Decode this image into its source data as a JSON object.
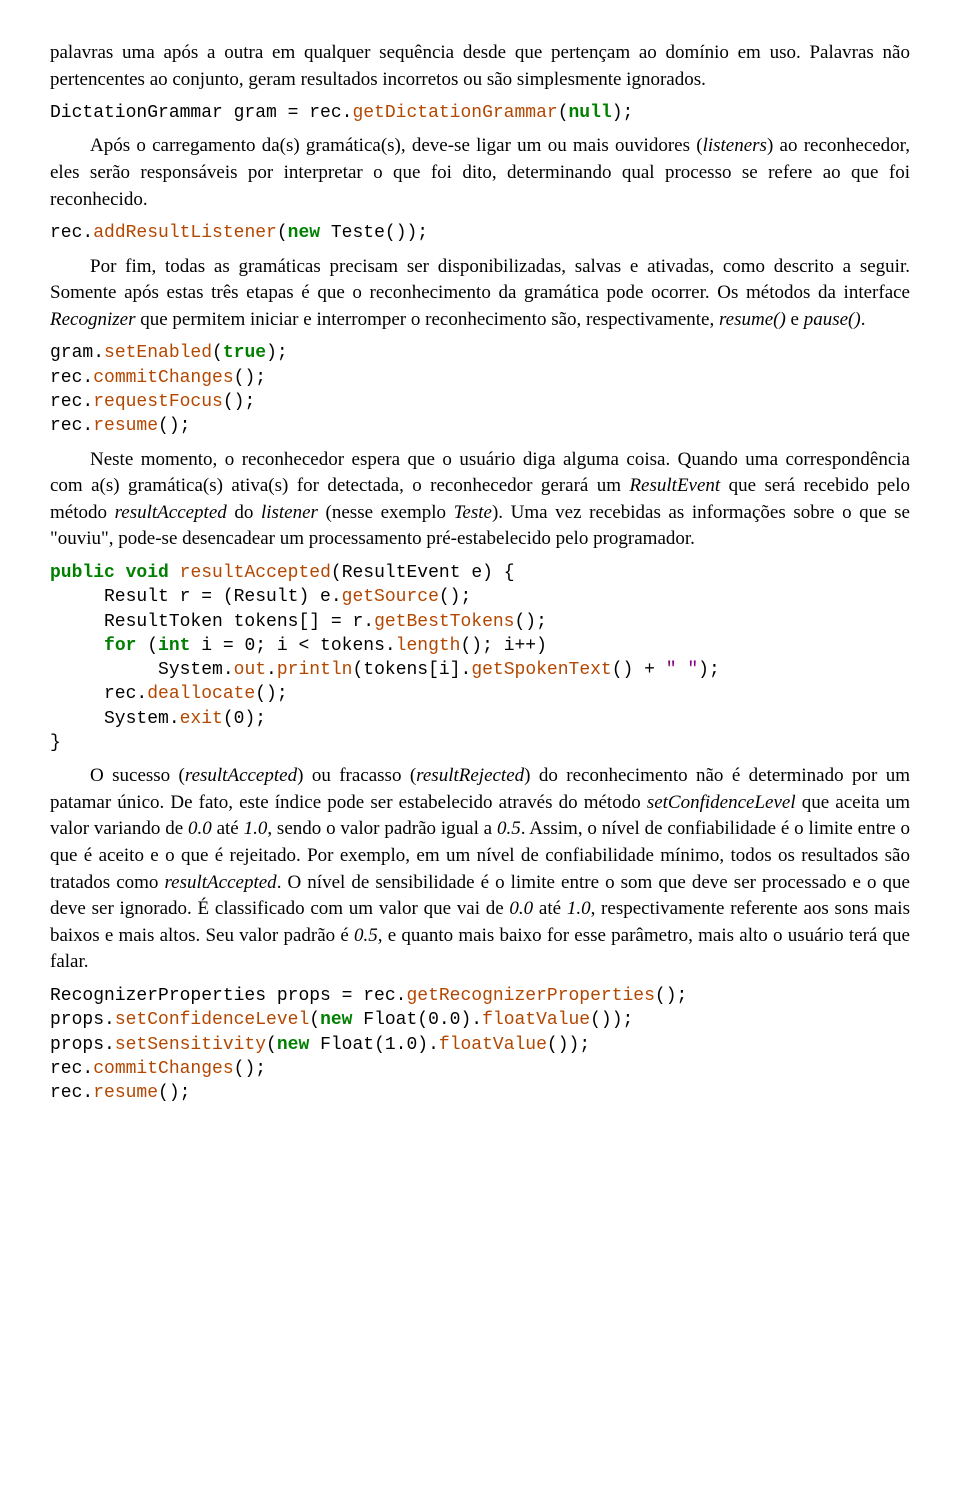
{
  "p1": "palavras uma após a outra em qualquer sequência desde que pertençam ao domínio em uso. Palavras não pertencentes ao conjunto, geram resultados incorretos ou são simplesmente ignorados.",
  "c1": {
    "a": "DictationGrammar gram = rec.",
    "b": "getDictationGrammar",
    "c": "(",
    "d": "null",
    "e": ");"
  },
  "p2a": "Após o carregamento da(s) gramática(s), deve-se ligar um ou mais ouvidores (",
  "p2b": "listeners",
  "p2c": ") ao reconhecedor, eles serão responsáveis por interpretar o que foi dito, determinando qual processo se refere ao que foi reconhecido.",
  "c2": {
    "a": "rec.",
    "b": "addResultListener",
    "c": "(",
    "d": "new",
    "e": " Teste());"
  },
  "p3a": "Por fim, todas as gramáticas precisam ser disponibilizadas, salvas e ativadas, como descrito a seguir. Somente após estas três etapas é que o reconhecimento da gramática pode ocorrer. Os métodos da interface ",
  "p3b": "Recognizer",
  "p3c": " que permitem iniciar e interromper o reconhecimento são, respectivamente, ",
  "p3d": "resume()",
  "p3e": " e ",
  "p3f": "pause()",
  "p3g": ".",
  "c3": {
    "l1a": "gram.",
    "l1b": "setEnabled",
    "l1c": "(",
    "l1d": "true",
    "l1e": ");",
    "l2a": "rec.",
    "l2b": "commitChanges",
    "l2c": "();",
    "l3a": "rec.",
    "l3b": "requestFocus",
    "l3c": "();",
    "l4a": "rec.",
    "l4b": "resume",
    "l4c": "();"
  },
  "p4a": "Neste momento, o reconhecedor espera que o usuário diga alguma coisa. Quando uma correspondência com a(s) gramática(s) ativa(s) for detectada, o reconhecedor gerará um ",
  "p4b": "ResultEvent",
  "p4c": " que será recebido pelo método ",
  "p4d": "resultAccepted",
  "p4e": " do ",
  "p4f": "listener",
  "p4g": " (nesse exemplo ",
  "p4h": "Teste",
  "p4i": "). Uma vez recebidas as informações sobre o que se \"ouviu\", pode-se desencadear um processamento pré-estabelecido pelo programador.",
  "c4": {
    "l1a": "public",
    "l1b": " ",
    "l1c": "void",
    "l1d": " ",
    "l1e": "resultAccepted",
    "l1f": "(ResultEvent e) {",
    "l2a": "     Result r = (Result) e.",
    "l2b": "getSource",
    "l2c": "();",
    "l3a": "     ResultToken tokens[] = r.",
    "l3b": "getBestTokens",
    "l3c": "();",
    "l4a": "     ",
    "l4b": "for",
    "l4c": " (",
    "l4d": "int",
    "l4e": " i = 0; i < tokens.",
    "l4f": "length",
    "l4g": "(); i++)",
    "l5a": "          System.",
    "l5b": "out",
    "l5c": ".",
    "l5d": "println",
    "l5e": "(tokens[i].",
    "l5f": "getSpokenText",
    "l5g": "() + ",
    "l5h": "\" \"",
    "l5i": ");",
    "l6a": "     rec.",
    "l6b": "deallocate",
    "l6c": "();",
    "l7a": "     System.",
    "l7b": "exit",
    "l7c": "(0);",
    "l8": "}"
  },
  "p5a": "O sucesso (",
  "p5b": "resultAccepted",
  "p5c": ") ou fracasso (",
  "p5d": "resultRejected",
  "p5e": ") do reconhecimento não é determinado por um patamar único. De fato, este índice pode ser estabelecido através do método ",
  "p5f": "setConfidenceLevel",
  "p5g": " que aceita um valor variando de ",
  "p5h": "0.0",
  "p5i": " até ",
  "p5j": "1.0",
  "p5k": ", sendo o valor padrão igual a ",
  "p5l": "0.5",
  "p5m": ". Assim, o nível de confiabilidade é o limite entre o que é aceito e o que é rejeitado. Por exemplo, em um nível de confiabilidade mínimo, todos os resultados são tratados como ",
  "p5n": "resultAccepted",
  "p5o": ". O nível de sensibilidade é o limite entre o som que deve ser processado e o que deve ser ignorado. É classificado com um valor que vai de ",
  "p5p": "0.0",
  "p5q": " até ",
  "p5r": "1.0",
  "p5s": ", respectivamente referente aos sons mais baixos e mais altos. Seu valor padrão é ",
  "p5t": "0.5",
  "p5u": ", e quanto mais baixo for esse parâmetro, mais alto o usuário terá que falar.",
  "c5": {
    "l1a": "RecognizerProperties props = rec.",
    "l1b": "getRecognizerProperties",
    "l1c": "();",
    "l2a": "props.",
    "l2b": "setConfidenceLevel",
    "l2c": "(",
    "l2d": "new",
    "l2e": " Float(0.0).",
    "l2f": "floatValue",
    "l2g": "());",
    "l3a": "props.",
    "l3b": "setSensitivity",
    "l3c": "(",
    "l3d": "new",
    "l3e": " Float(1.0).",
    "l3f": "floatValue",
    "l3g": "());",
    "l4a": "rec.",
    "l4b": "commitChanges",
    "l4c": "();",
    "l5a": "rec.",
    "l5b": "resume",
    "l5c": "();"
  }
}
